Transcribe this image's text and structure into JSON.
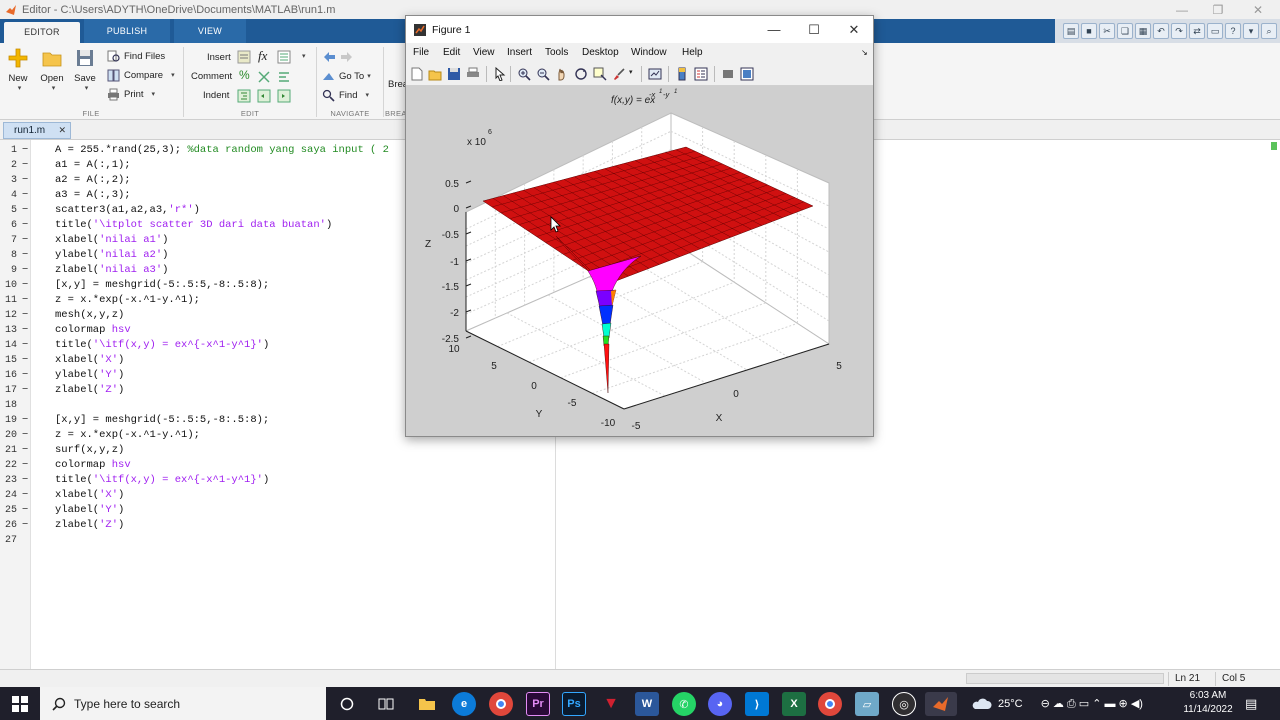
{
  "window": {
    "title": "Editor - C:\\Users\\ADYTH\\OneDrive\\Documents\\MATLAB\\run1.m"
  },
  "ribbon": {
    "tabs": [
      {
        "label": "EDITOR"
      },
      {
        "label": "PUBLISH"
      },
      {
        "label": "VIEW"
      }
    ],
    "file": {
      "section": "FILE",
      "new": "New",
      "open": "Open",
      "save": "Save",
      "find_files": "Find Files",
      "compare": "Compare",
      "print": "Print"
    },
    "edit": {
      "section": "EDIT",
      "insert": "Insert",
      "comment": "Comment",
      "indent": "Indent"
    },
    "navigate": {
      "section": "NAVIGATE",
      "go_to": "Go To",
      "find": "Find"
    },
    "breakpoints": {
      "section_partial": "BREA",
      "button_partial": "Brea"
    }
  },
  "editor": {
    "file_tab": "run1.m",
    "lines": [
      {
        "n": "1",
        "dash": "−",
        "parts": [
          {
            "t": "A = 255.*rand(25,3); "
          },
          {
            "t": "%data random yang saya input ( 2",
            "k": "c"
          }
        ]
      },
      {
        "n": "2",
        "dash": "−",
        "parts": [
          {
            "t": "a1 = A(:,1);"
          }
        ]
      },
      {
        "n": "3",
        "dash": "−",
        "parts": [
          {
            "t": "a2 = A(:,2);"
          }
        ]
      },
      {
        "n": "4",
        "dash": "−",
        "parts": [
          {
            "t": "a3 = A(:,3);"
          }
        ]
      },
      {
        "n": "5",
        "dash": "−",
        "parts": [
          {
            "t": "scatter3(a1,a2,a3,"
          },
          {
            "t": "'r*'",
            "k": "s"
          },
          {
            "t": ")"
          }
        ]
      },
      {
        "n": "6",
        "dash": "−",
        "parts": [
          {
            "t": "title("
          },
          {
            "t": "'\\itplot scatter 3D dari data buatan'",
            "k": "s"
          },
          {
            "t": ")"
          }
        ]
      },
      {
        "n": "7",
        "dash": "−",
        "parts": [
          {
            "t": "xlabel("
          },
          {
            "t": "'nilai a1'",
            "k": "s"
          },
          {
            "t": ")"
          }
        ]
      },
      {
        "n": "8",
        "dash": "−",
        "parts": [
          {
            "t": "ylabel("
          },
          {
            "t": "'nilai a2'",
            "k": "s"
          },
          {
            "t": ")"
          }
        ]
      },
      {
        "n": "9",
        "dash": "−",
        "parts": [
          {
            "t": "zlabel("
          },
          {
            "t": "'nilai a3'",
            "k": "s"
          },
          {
            "t": ")"
          }
        ]
      },
      {
        "n": "10",
        "dash": "−",
        "parts": [
          {
            "t": "[x,y] = meshgrid(-5:.5:5,-8:.5:8);"
          }
        ]
      },
      {
        "n": "11",
        "dash": "−",
        "parts": [
          {
            "t": "z = x.*exp(-x.^1-y.^1);"
          }
        ]
      },
      {
        "n": "12",
        "dash": "−",
        "parts": [
          {
            "t": "mesh(x,y,z)"
          }
        ]
      },
      {
        "n": "13",
        "dash": "−",
        "parts": [
          {
            "t": "colormap "
          },
          {
            "t": "hsv",
            "k": "s"
          }
        ]
      },
      {
        "n": "14",
        "dash": "−",
        "parts": [
          {
            "t": "title("
          },
          {
            "t": "'\\itf(x,y) = ex^{-x^1-y^1}'",
            "k": "s"
          },
          {
            "t": ")"
          }
        ]
      },
      {
        "n": "15",
        "dash": "−",
        "parts": [
          {
            "t": "xlabel("
          },
          {
            "t": "'X'",
            "k": "s"
          },
          {
            "t": ")"
          }
        ]
      },
      {
        "n": "16",
        "dash": "−",
        "parts": [
          {
            "t": "ylabel("
          },
          {
            "t": "'Y'",
            "k": "s"
          },
          {
            "t": ")"
          }
        ]
      },
      {
        "n": "17",
        "dash": "−",
        "parts": [
          {
            "t": "zlabel("
          },
          {
            "t": "'Z'",
            "k": "s"
          },
          {
            "t": ")"
          }
        ]
      },
      {
        "n": "18",
        "dash": "",
        "parts": []
      },
      {
        "n": "19",
        "dash": "−",
        "parts": [
          {
            "t": "[x,y] = meshgrid(-5:.5:5,-8:.5:8);"
          }
        ]
      },
      {
        "n": "20",
        "dash": "−",
        "parts": [
          {
            "t": "z = x.*exp(-x.^1-y.^1);"
          }
        ]
      },
      {
        "n": "21",
        "dash": "−",
        "parts": [
          {
            "t": "surf(x,y,z)"
          }
        ]
      },
      {
        "n": "22",
        "dash": "−",
        "parts": [
          {
            "t": "colormap "
          },
          {
            "t": "hsv",
            "k": "s"
          }
        ]
      },
      {
        "n": "23",
        "dash": "−",
        "parts": [
          {
            "t": "title("
          },
          {
            "t": "'\\itf(x,y) = ex^{-x^1-y^1}'",
            "k": "s"
          },
          {
            "t": ")"
          }
        ]
      },
      {
        "n": "24",
        "dash": "−",
        "parts": [
          {
            "t": "xlabel("
          },
          {
            "t": "'X'",
            "k": "s"
          },
          {
            "t": ")"
          }
        ]
      },
      {
        "n": "25",
        "dash": "−",
        "parts": [
          {
            "t": "ylabel("
          },
          {
            "t": "'Y'",
            "k": "s"
          },
          {
            "t": ")"
          }
        ]
      },
      {
        "n": "26",
        "dash": "−",
        "parts": [
          {
            "t": "zlabel("
          },
          {
            "t": "'Z'",
            "k": "s"
          },
          {
            "t": ")"
          }
        ]
      },
      {
        "n": "27",
        "dash": "",
        "parts": []
      }
    ]
  },
  "status": {
    "line": "Ln  21",
    "col": "Col  5"
  },
  "figure": {
    "title": "Figure 1",
    "menu": [
      "File",
      "Edit",
      "View",
      "Insert",
      "Tools",
      "Desktop",
      "Window",
      "Help"
    ],
    "toolbar_icons": [
      "new-figure-icon",
      "open-file-icon",
      "save-icon",
      "print-icon",
      "pointer-icon",
      "zoom-in-icon",
      "zoom-out-icon",
      "pan-icon",
      "rotate-3d-icon",
      "data-cursor-icon",
      "brush-icon",
      "link-plot-icon",
      "colorbar-icon",
      "legend-icon",
      "hide-plot-tools-icon",
      "show-plot-tools-icon"
    ],
    "plot": {
      "title_main": "f(x,y) = ex",
      "title_exp": "-x",
      "title_exp_sup": "1",
      "title_exp_mid": "-y",
      "title_exp_sup2": "1",
      "z_multiplier": "x 10",
      "z_multiplier_exp": "6",
      "zlabel": "Z",
      "xlabel": "X",
      "ylabel": "Y",
      "z_ticks": [
        "0.5",
        "0",
        "-0.5",
        "-1",
        "-1.5",
        "-2",
        "-2.5"
      ],
      "y_ticks": [
        "10",
        "5",
        "0",
        "-5",
        "-10"
      ],
      "x_ticks": [
        "-5",
        "0",
        "5"
      ],
      "surface_color": "#d01010",
      "colormap": "hsv"
    }
  },
  "chart_data": {
    "type": "surface",
    "function": "z = x.*exp(-x.^1-y.^1)",
    "title": "f(x,y) = ex^{-x^1-y^1}",
    "xlabel": "X",
    "ylabel": "Y",
    "zlabel": "Z",
    "xlim": [
      -5,
      5
    ],
    "ylim": [
      -10,
      10
    ],
    "zlim": [
      -2.5,
      0.5
    ],
    "z_scale": "x 10^6",
    "x_ticks": [
      -5,
      0,
      5
    ],
    "y_ticks": [
      -10,
      -5,
      0,
      5,
      10
    ],
    "z_ticks": [
      -2.5,
      -2,
      -1.5,
      -1,
      -0.5,
      0,
      0.5
    ],
    "grid": true,
    "colormap": "hsv"
  },
  "taskbar": {
    "search_placeholder": "Type here to search",
    "apps": [
      "cortana-icon",
      "task-view-icon",
      "file-explorer-icon",
      "edge-icon",
      "chrome-icon",
      "premiere-icon",
      "photoshop-icon",
      "vivado-icon",
      "word-icon",
      "whatsapp-icon",
      "discord-icon",
      "vscode-icon",
      "excel-icon",
      "chrome-icon-2",
      "app-icon",
      "obs-icon",
      "matlab-icon"
    ],
    "weather": "25°C",
    "time": "6:03 AM",
    "date": "11/14/2022"
  }
}
